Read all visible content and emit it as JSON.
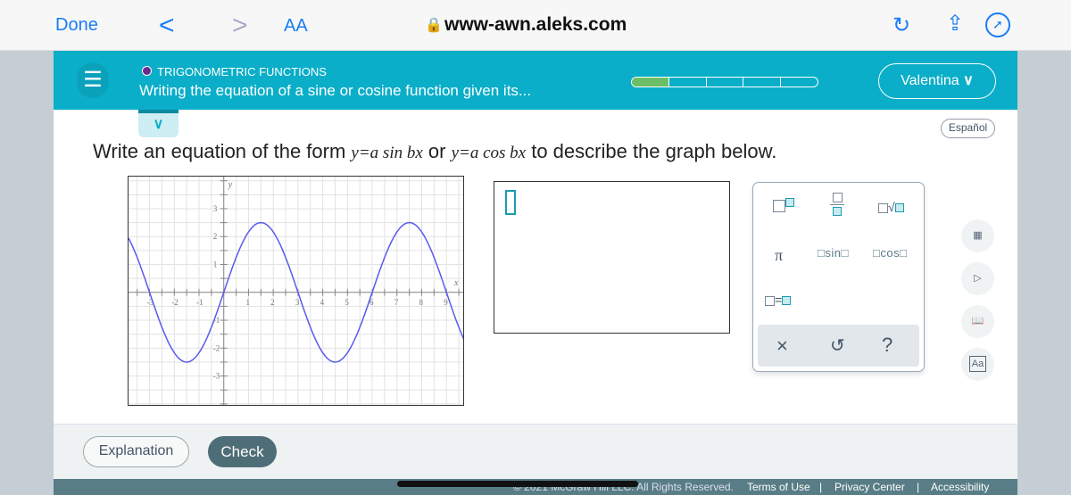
{
  "browser": {
    "done": "Done",
    "back": "<",
    "forward": ">",
    "text_size": "AA",
    "url": "www-awn.aleks.com",
    "lock_icon": "lock-icon",
    "reload_icon": "reload-icon",
    "share_icon": "share-icon",
    "compass_icon": "compass-icon"
  },
  "header": {
    "topic": "TRIGONOMETRIC FUNCTIONS",
    "title": "Writing the equation of a sine or cosine function given its...",
    "progress_fraction": 0.2,
    "user": "Valentina",
    "topic_color": "#6b2a8c",
    "bar_color": "#0aaec8",
    "progress_color": "#6dbf67"
  },
  "language": "Español",
  "question": {
    "prefix": "Write an equation of the form ",
    "form1": "y=a sin bx",
    "or": " or ",
    "form2": "y=a cos bx",
    "suffix": " to describe the graph below."
  },
  "chart_data": {
    "type": "line",
    "function": "y = 2.5 sin(πx/3)",
    "xlabel": "x",
    "ylabel": "y",
    "xlim": [
      -3.85,
      9.75
    ],
    "ylim": [
      -4.1,
      4.15
    ],
    "grid": true,
    "xticks": [
      "-3",
      "-2",
      "-1",
      "1",
      "2",
      "3",
      "4",
      "5",
      "6",
      "7",
      "8",
      "9"
    ],
    "yticks": [
      "3",
      "2",
      "1",
      "-1",
      "-2",
      "-3"
    ],
    "series": [
      {
        "color": "#5a5af0",
        "points": [
          [
            -3,
            0
          ],
          [
            -1.5,
            -2.5
          ],
          [
            0,
            0
          ],
          [
            1.5,
            2.5
          ],
          [
            3,
            0
          ],
          [
            4.5,
            -2.5
          ],
          [
            6,
            0
          ],
          [
            7.5,
            2.5
          ],
          [
            9,
            0
          ]
        ]
      }
    ]
  },
  "keypad": {
    "keys": [
      "□^□",
      "□/□",
      "□√□",
      "π",
      "□sin□",
      "□cos□",
      "□=□"
    ],
    "sin": "sin",
    "cos": "cos",
    "pi": "π",
    "eq": "=",
    "clear": "×",
    "undo": "↺",
    "help": "?"
  },
  "side_tools": {
    "aa": "Aa"
  },
  "buttons": {
    "explanation": "Explanation",
    "check": "Check"
  },
  "footer": {
    "copyright": "© 2021 McGraw Hill LLC. All Rights Reserved.",
    "terms": "Terms of Use",
    "privacy": "Privacy Center",
    "accessibility": "Accessibility",
    "sep": "|"
  }
}
